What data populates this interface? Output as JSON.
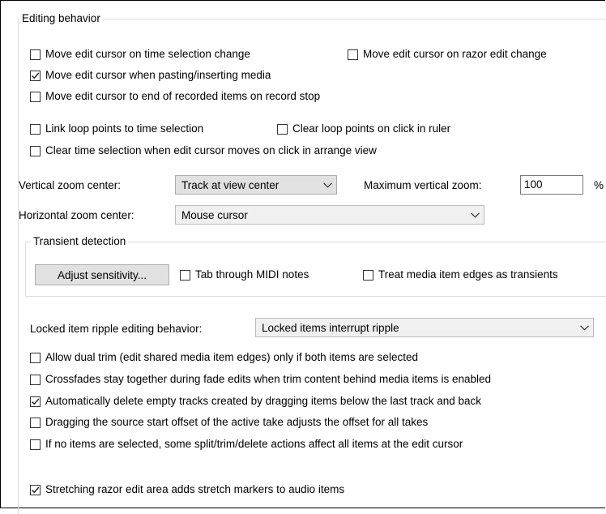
{
  "editing_behavior": {
    "title": "Editing behavior",
    "options": [
      {
        "label": "Move edit cursor on time selection change",
        "checked": false
      },
      {
        "label": "Move edit cursor on razor edit change",
        "checked": false
      },
      {
        "label": "Move edit cursor when pasting/inserting media",
        "checked": true
      },
      {
        "label": "Move edit cursor to end of recorded items on record stop",
        "checked": false
      },
      {
        "label": "Link loop points to time selection",
        "checked": false
      },
      {
        "label": "Clear loop points on click in ruler",
        "checked": false
      },
      {
        "label": "Clear time selection when edit cursor moves on click in arrange view",
        "checked": false
      }
    ],
    "vertical_zoom_label": "Vertical zoom center:",
    "vertical_zoom_value": "Track at view center",
    "max_vertical_zoom_label": "Maximum vertical zoom:",
    "max_vertical_zoom_value": "100",
    "max_vertical_zoom_unit": "%",
    "horizontal_zoom_label": "Horizontal zoom center:",
    "horizontal_zoom_value": "Mouse cursor",
    "transient": {
      "title": "Transient detection",
      "adjust_button": "Adjust sensitivity...",
      "options": [
        {
          "label": "Tab through MIDI notes",
          "checked": false
        },
        {
          "label": "Treat media item edges as transients",
          "checked": false
        }
      ]
    },
    "locked_ripple_label": "Locked item ripple editing behavior:",
    "locked_ripple_value": "Locked items interrupt ripple",
    "more_options": [
      {
        "label": "Allow dual trim (edit shared media item edges) only if both items are selected",
        "checked": false
      },
      {
        "label": "Crossfades stay together during fade edits when trim content behind media items is enabled",
        "checked": false
      },
      {
        "label": "Automatically delete empty tracks created by dragging items below the last track and back",
        "checked": true
      },
      {
        "label": "Dragging the source start offset of the active take adjusts the offset for all takes",
        "checked": false
      },
      {
        "label": "If no items are selected, some split/trim/delete actions affect all items at the edit cursor",
        "checked": false
      },
      {
        "label": "Stretching razor edit area adds stretch markers to audio items",
        "checked": true
      }
    ]
  }
}
